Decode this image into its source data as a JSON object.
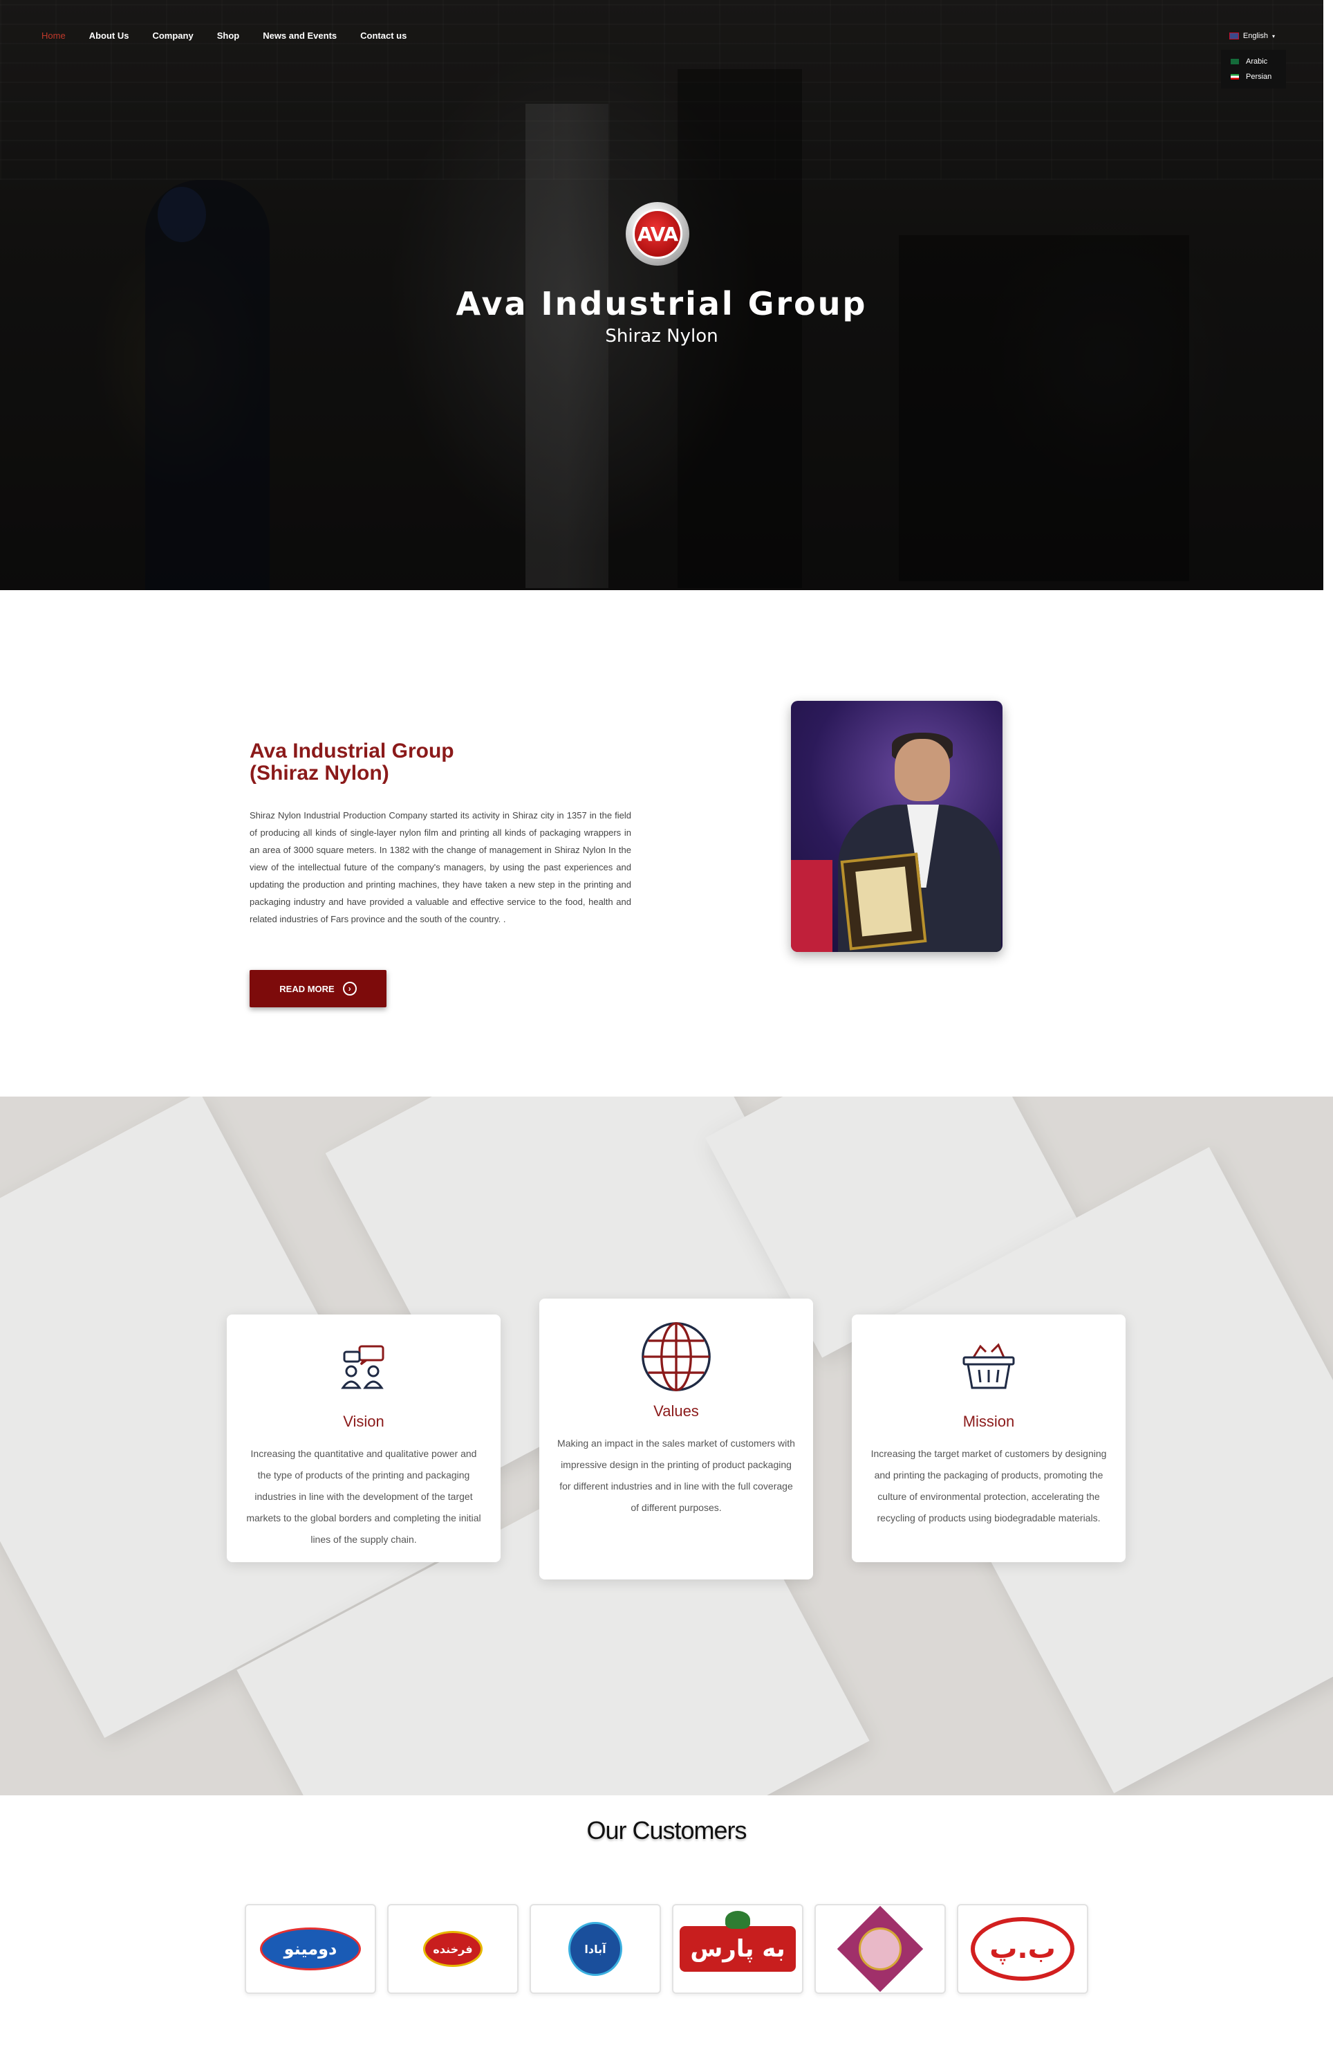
{
  "nav": {
    "items": [
      "Home",
      "About Us",
      "Company",
      "Shop",
      "News and Events",
      "Contact us"
    ],
    "active": "Home"
  },
  "language": {
    "current": "English",
    "options": [
      "Arabic",
      "Persian"
    ]
  },
  "hero": {
    "logo_text": "AVA",
    "title": "Ava Industrial Group",
    "subtitle": "Shiraz Nylon"
  },
  "about": {
    "title_line1": "Ava Industrial Group",
    "title_line2": "(Shiraz Nylon)",
    "body": "Shiraz Nylon Industrial Production Company started its activity in Shiraz city in 1357 in the field of producing all kinds of single-layer nylon film and printing all kinds of packaging wrappers in an area of 3000 square meters. In 1382 with the change of management in Shiraz Nylon In the view of the intellectual future of the company's managers, by using the past experiences and updating the production and printing machines, they have taken a new step in the printing and packaging industry and have provided a valuable and effective service to the food, health and related industries of Fars province and the south of the country. .",
    "button_label": "READ MORE"
  },
  "values_section": {
    "cards": [
      {
        "icon": "people-chat-icon",
        "title": "Vision",
        "text": "Increasing the quantitative and qualitative power and the type of products of the printing and packaging industries in line with the development of the target markets to the global borders and completing the initial lines of the supply chain."
      },
      {
        "icon": "globe-icon",
        "title": "Values",
        "text": "Making an impact in the sales market of customers with impressive design in the printing of product packaging for different industries and in line with the full coverage of different purposes."
      },
      {
        "icon": "shopping-basket-icon",
        "title": "Mission",
        "text": "Increasing the target market of customers by designing and printing the packaging of products, promoting the culture of environmental protection, accelerating the recycling of products using biodegradable materials."
      }
    ]
  },
  "customers": {
    "title": "Our Customers",
    "logos": [
      {
        "name": "domino-logo",
        "text": "دومینو",
        "color": "#1a5bb5"
      },
      {
        "name": "farkhondeh-logo",
        "text": "فرخنده",
        "color": "#c81e1e"
      },
      {
        "name": "abada-logo",
        "text": "آبادا",
        "color": "#1a4f9c"
      },
      {
        "name": "behparas-logo",
        "text": "به پارس",
        "color": "#c81e1e"
      },
      {
        "name": "ladan-logo",
        "text": "",
        "color": "#a0306a"
      },
      {
        "name": "bp-logo",
        "text": "ب.پ",
        "color": "#d21f1f"
      }
    ]
  },
  "colors": {
    "brand_red": "#8b1a1a",
    "button_red": "#7d0b0b",
    "nav_active": "#c0392b"
  }
}
